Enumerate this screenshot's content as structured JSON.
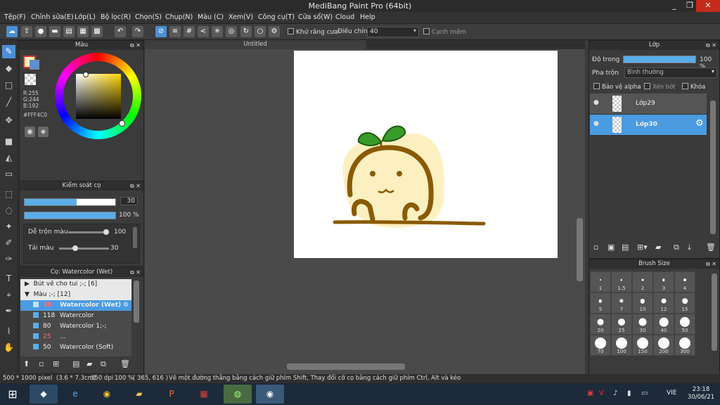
{
  "window": {
    "title": "MediBang Paint Pro (64bit)",
    "minimize": "_",
    "maximize": "❐",
    "close": "✕"
  },
  "menu": [
    "Tệp(F)",
    "Chỉnh sửa(E)",
    "Lớp(L)",
    "Bộ lọc(R)",
    "Chọn(S)",
    "Chụp(N)",
    "Màu (C)",
    "Xem(V)",
    "Công cụ(T)",
    "Cửa sổ(W)",
    "Cloud",
    "Help"
  ],
  "toolbar": {
    "antialias_label": "Khử răng cưa",
    "adjust_label": "Điều chỉnh",
    "adjust_value": "40",
    "snap_label": "Cạnh mềm"
  },
  "color_panel": {
    "title": "Màu",
    "r": "R:255",
    "g": "G:244",
    "b": "B:192",
    "hex": "#FFF4C0",
    "primary_color": "#FFF4C0"
  },
  "brush_control": {
    "title": "Kiểm soát cọ",
    "size_value": "30",
    "opacity_value": "100 %",
    "mix_label": "Dễ trộn màu",
    "mix_value": "100",
    "reload_label": "Tải màu",
    "reload_value": "30"
  },
  "brush_list": {
    "title": "Cọ: Watercolor (Wet)",
    "groups": [
      {
        "label": "Bút vẽ cho tui ;-; [6]"
      },
      {
        "label": "Màu ;-; [12]"
      }
    ],
    "items": [
      {
        "size": "30",
        "name": "Watercolor (Wet)",
        "selected": true,
        "size_color": "#ff6a6a"
      },
      {
        "size": "118",
        "name": "Watercolor"
      },
      {
        "size": "80",
        "name": "Watercolor 1;-;"
      },
      {
        "size": "25",
        "name": "...",
        "size_color": "#ff6a6a"
      },
      {
        "size": "50",
        "name": "Watercolor (Soft)"
      }
    ]
  },
  "canvas": {
    "tab_title": "Untitled"
  },
  "layers_panel": {
    "title": "Lớp",
    "opacity_label": "Độ trong",
    "opacity_value": "100 %",
    "opacity_fraction": 1.0,
    "blend_label": "Pha trộn",
    "blend_value": "Bình thường",
    "protect_alpha": "Bảo vệ alpha",
    "clipping": "Xén bớt",
    "lock": "Khóa",
    "layers": [
      {
        "name": "Lớp29",
        "selected": false
      },
      {
        "name": "Lớp30",
        "selected": true
      }
    ]
  },
  "brush_size_panel": {
    "title": "Brush Size",
    "sizes": [
      "1",
      "1.5",
      "2",
      "3",
      "4",
      "5",
      "7",
      "10",
      "12",
      "15",
      "20",
      "25",
      "30",
      "40",
      "50",
      "70",
      "100",
      "150",
      "200",
      "300"
    ]
  },
  "status": {
    "dims": "500 * 1000 pixel",
    "cm": "(3.6 * 7.3cm)",
    "dpi": "350 dpi",
    "zoom": "100 %",
    "coords": "( 365, 616 )",
    "hint": "Vẽ một đường thẳng bằng cách giữ phím Shift, Thay đổi cỡ cọ bằng cách giữ phím Ctrl, Alt và kéo"
  },
  "taskbar": {
    "lang": "VIE",
    "time": "23:18",
    "date": "30/06/21"
  }
}
